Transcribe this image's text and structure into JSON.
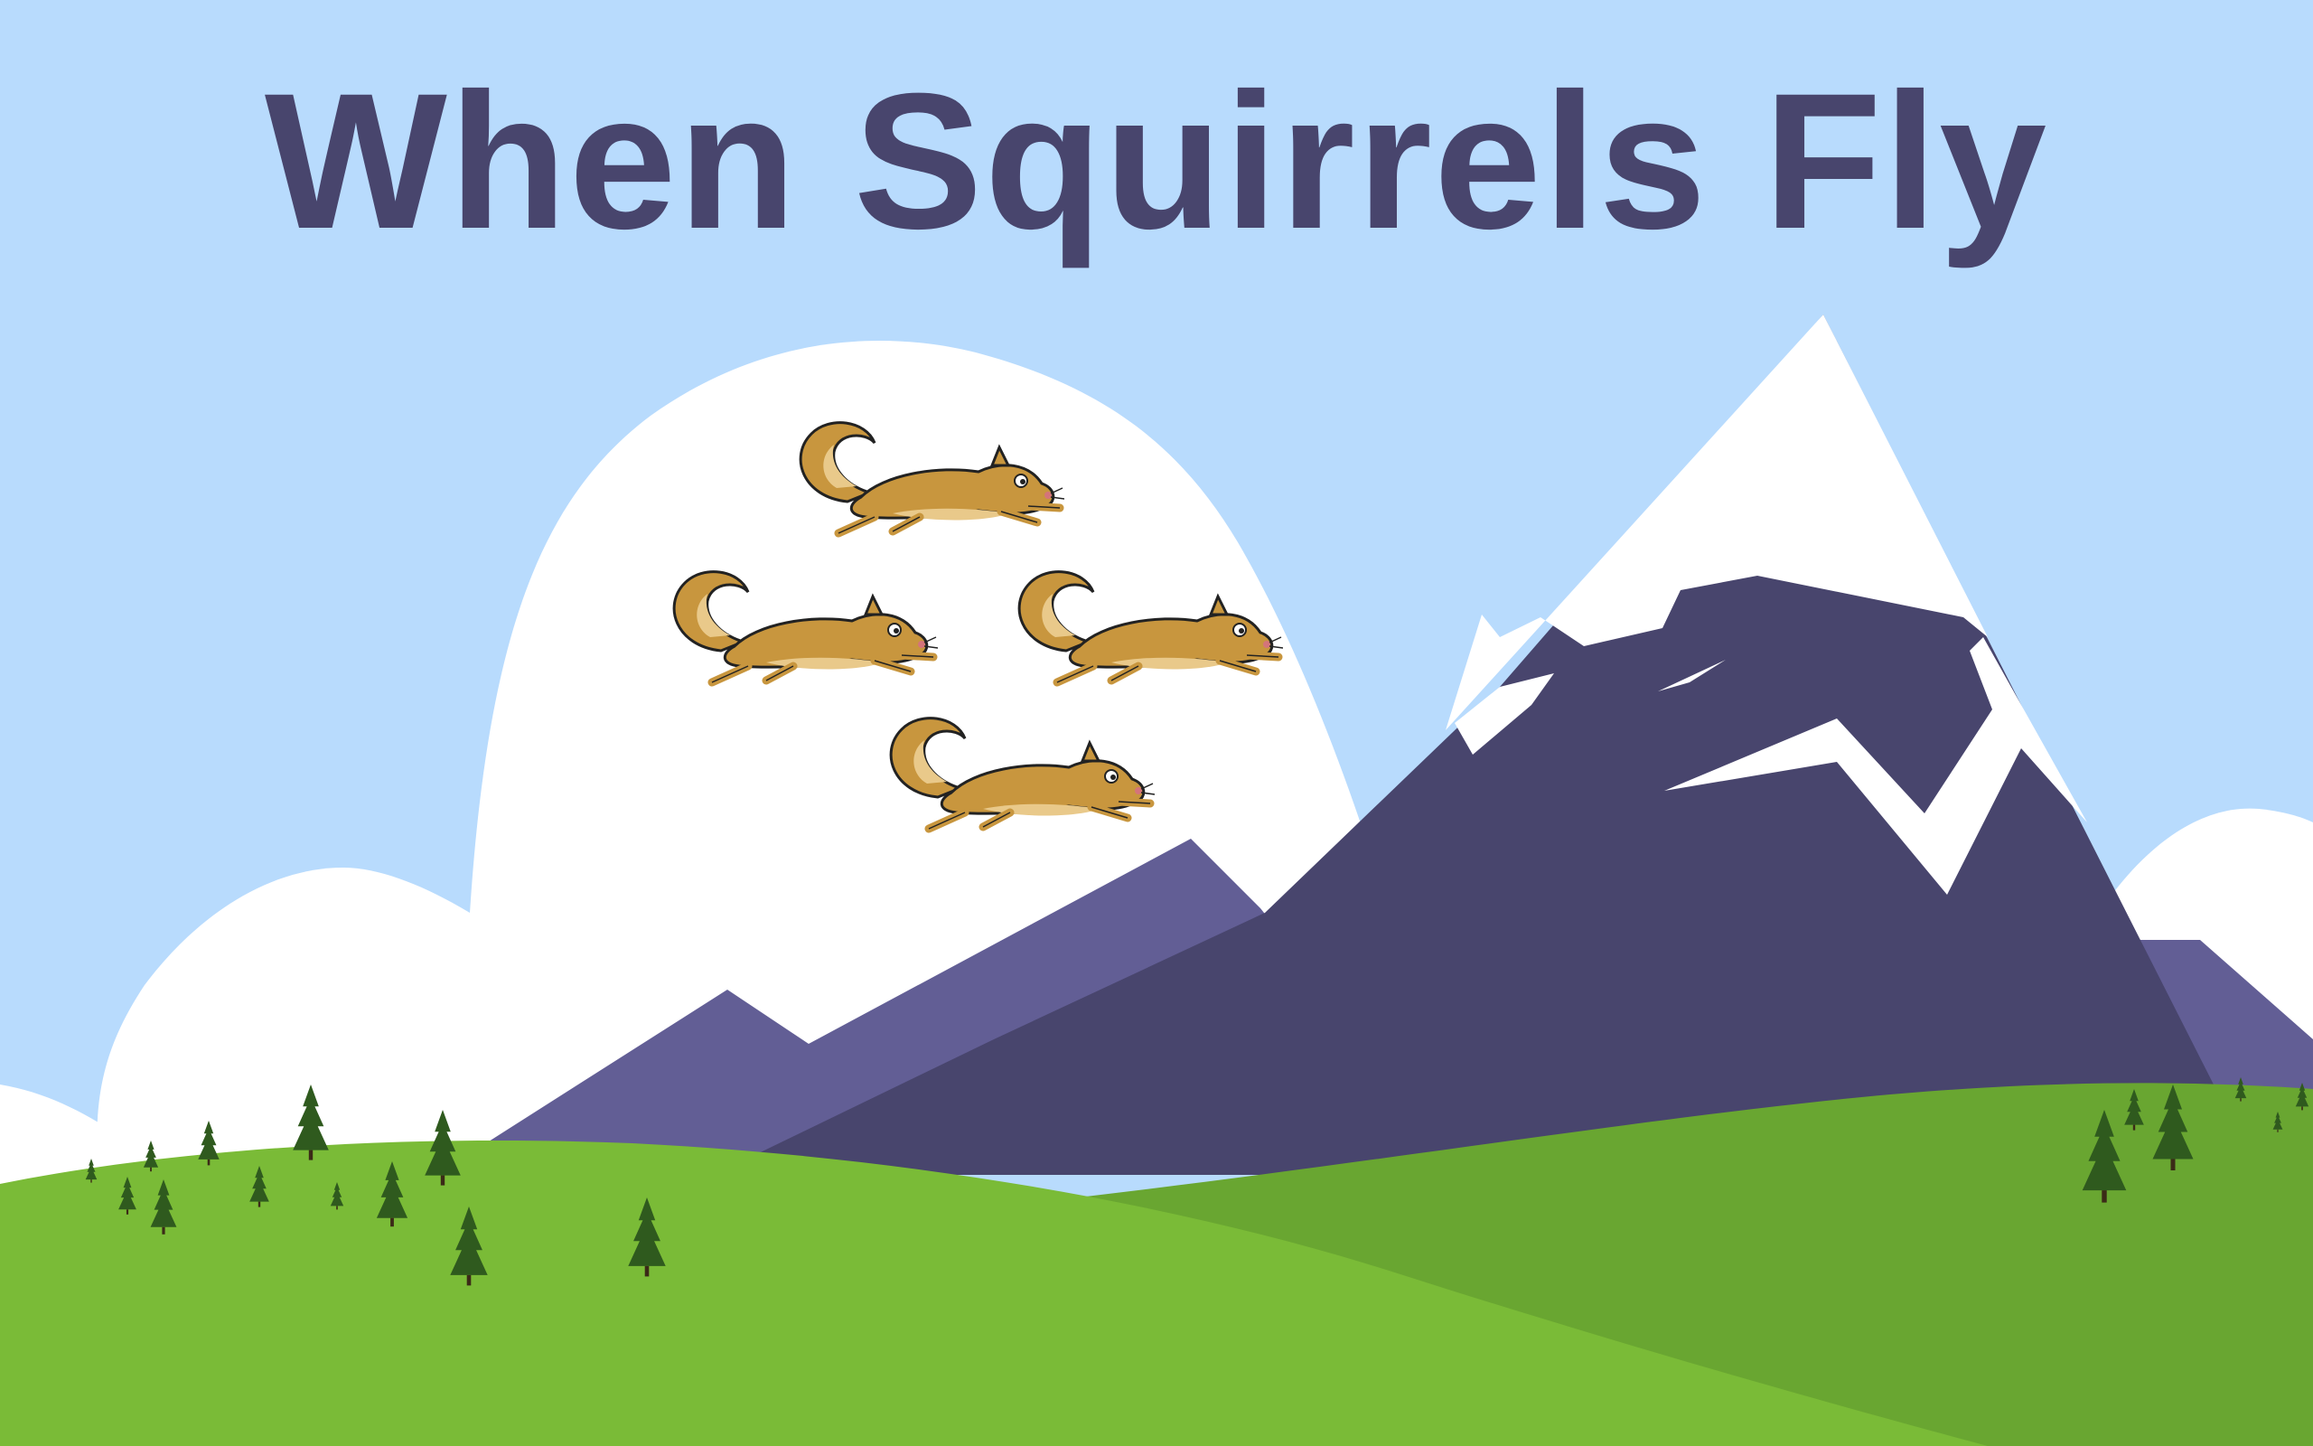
{
  "title": "When Squirrels Fly",
  "colors": {
    "sky": "#b8dbfd",
    "cloud": "#ffffff",
    "title": "#48456d",
    "mountain_dark": "#48456d",
    "mountain_light": "#625e95",
    "snow": "#ffffff",
    "hill_front": "#7abb37",
    "hill_back": "#69a631",
    "tree_dark": "#2f5a1e",
    "tree_light": "#3d6a27",
    "squirrel_body": "#c8963e",
    "squirrel_light": "#e9c98a"
  },
  "icons": {
    "squirrel": "flying-squirrel-icon",
    "tree": "pine-tree-icon"
  }
}
